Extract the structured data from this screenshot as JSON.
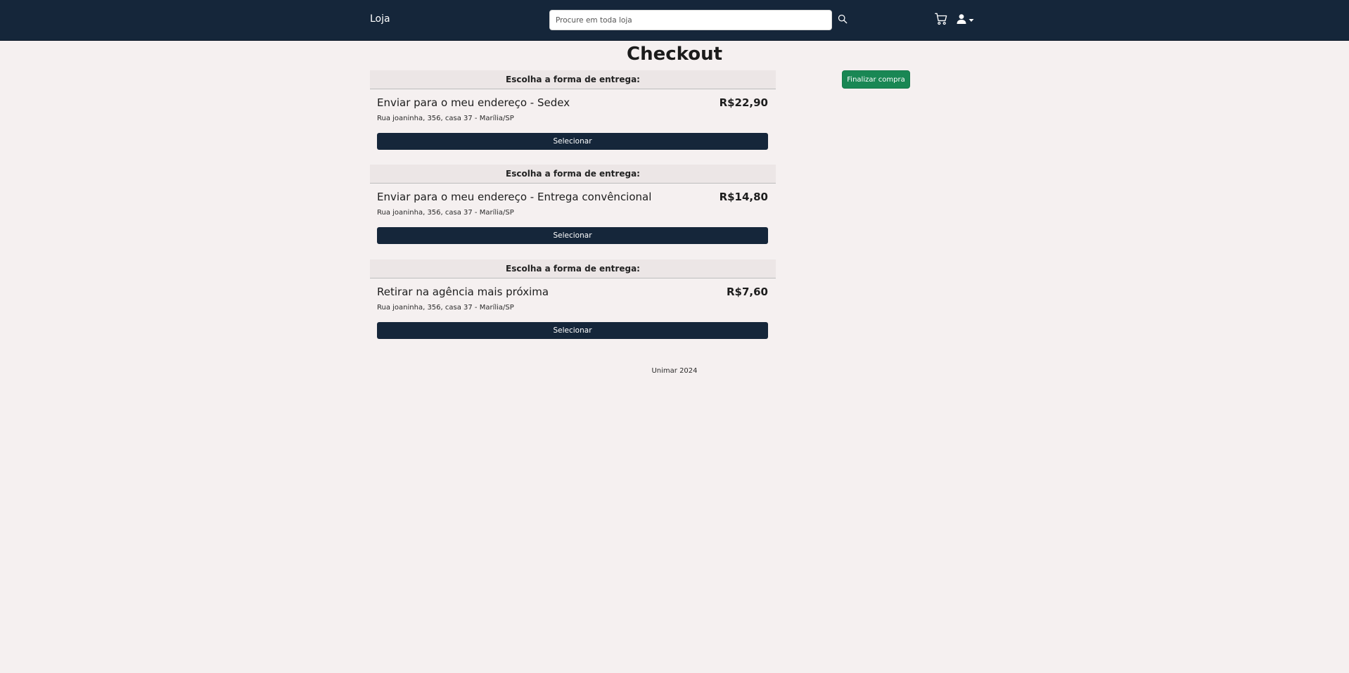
{
  "navbar": {
    "brand": "Loja",
    "search_placeholder": "Procure em toda loja",
    "icons": [
      "search-icon",
      "cart-icon",
      "user-icon",
      "caret-down-icon"
    ]
  },
  "page": {
    "title": "Checkout",
    "finalize_label": "Finalizar compra"
  },
  "shipping_options": [
    {
      "header": "Escolha a forma de entrega:",
      "title": "Enviar para o meu endereço - Sedex",
      "price": "R$22,90",
      "address": "Rua joaninha, 356, casa 37 - Marília/SP",
      "button": "Selecionar"
    },
    {
      "header": "Escolha a forma de entrega:",
      "title": "Enviar para o meu endereço - Entrega convêncional",
      "price": "R$14,80",
      "address": "Rua joaninha, 356, casa 37 - Marília/SP",
      "button": "Selecionar"
    },
    {
      "header": "Escolha a forma de entrega:",
      "title": "Retirar na agência mais próxima",
      "price": "R$7,60",
      "address": "Rua joaninha, 356, casa 37 - Marília/SP",
      "button": "Selecionar"
    }
  ],
  "footer": {
    "text": "Unimar 2024"
  },
  "colors": {
    "navbar": "#15263a",
    "background": "#f5f0f0",
    "primary_button": "#15263a",
    "success_button": "#198754"
  }
}
